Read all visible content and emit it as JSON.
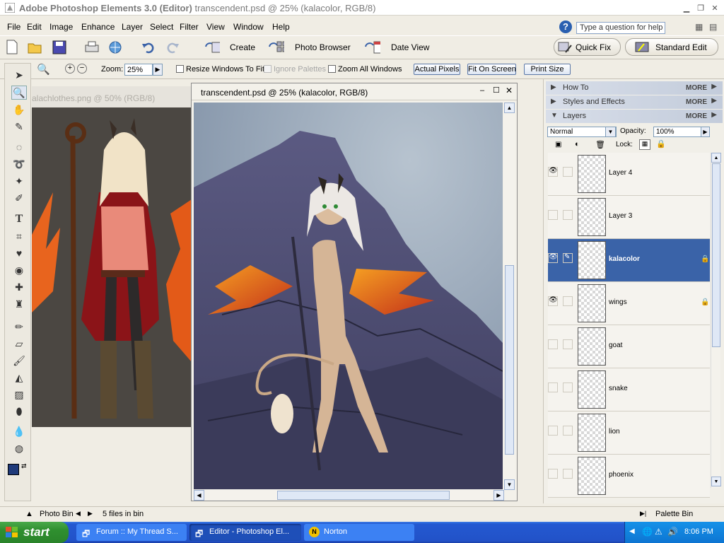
{
  "window": {
    "title_bold": "Adobe Photoshop Elements 3.0 (Editor)",
    "title_rest": " transcendent.psd @ 25% (kalacolor, RGB/8)"
  },
  "menu": [
    "File",
    "Edit",
    "Image",
    "Enhance",
    "Layer",
    "Select",
    "Filter",
    "View",
    "Window",
    "Help"
  ],
  "help_placeholder": "Type a question for help",
  "shortcuts": {
    "create": "Create",
    "photo_browser": "Photo Browser",
    "date_view": "Date View",
    "quick_fix": "Quick Fix",
    "standard_edit": "Standard Edit"
  },
  "options": {
    "zoom_label": "Zoom:",
    "zoom_value": "25%",
    "resize_windows": "Resize Windows To Fit",
    "ignore_palettes": "Ignore Palettes",
    "zoom_all": "Zoom All Windows",
    "actual_pixels": "Actual Pixels",
    "fit_on_screen": "Fit On Screen",
    "print_size": "Print Size"
  },
  "bg_document": {
    "title": "alachlothes.png @ 50% (RGB/8)"
  },
  "main_document": {
    "title": "transcendent.psd @ 25% (kalacolor, RGB/8)"
  },
  "palettes": {
    "how_to": "How To",
    "styles": "Styles and Effects",
    "layers": "Layers",
    "more": "MORE",
    "blend_mode": "Normal",
    "opacity_label": "Opacity:",
    "opacity_value": "100%",
    "lock_label": "Lock:"
  },
  "layers": [
    {
      "name": "Layer 4",
      "visible": true,
      "locked": false,
      "selected": false
    },
    {
      "name": "Layer 3",
      "visible": false,
      "locked": false,
      "selected": false
    },
    {
      "name": "kalacolor",
      "visible": true,
      "locked": true,
      "selected": true
    },
    {
      "name": "wings",
      "visible": true,
      "locked": true,
      "selected": false
    },
    {
      "name": "goat",
      "visible": false,
      "locked": false,
      "selected": false
    },
    {
      "name": "snake",
      "visible": false,
      "locked": false,
      "selected": false
    },
    {
      "name": "lion",
      "visible": false,
      "locked": false,
      "selected": false
    },
    {
      "name": "phoenix",
      "visible": false,
      "locked": false,
      "selected": false
    }
  ],
  "bin": {
    "photo_bin": "Photo Bin",
    "files": "5 files in bin",
    "palette_bin": "Palette Bin"
  },
  "taskbar": {
    "start": "start",
    "tasks": [
      "Forum :: My Thread S...",
      "Editor - Photoshop El...",
      "Norton"
    ],
    "time": "8:06 PM"
  },
  "colors": {
    "selected_layer": "#3a63a8",
    "foreground": "#1f3a7a",
    "background": "#ffffff"
  }
}
